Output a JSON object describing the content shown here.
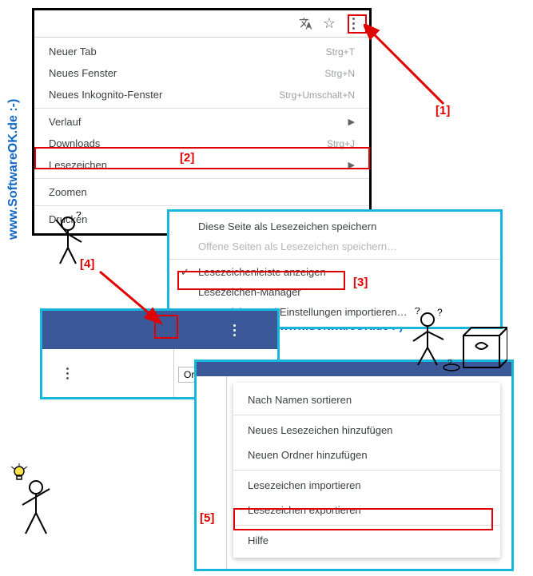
{
  "watermark": "www.SoftwareOK.de :-)",
  "steps": {
    "s1": "[1]",
    "s2": "[2]",
    "s3": "[3]",
    "s4": "[4]",
    "s5": "[5]"
  },
  "panel1": {
    "items": [
      {
        "label": "Neuer Tab",
        "shortcut": "Strg+T"
      },
      {
        "label": "Neues Fenster",
        "shortcut": "Strg+N"
      },
      {
        "label": "Neues Inkognito-Fenster",
        "shortcut": "Strg+Umschalt+N"
      }
    ],
    "verlauf": "Verlauf",
    "downloads": {
      "label": "Downloads",
      "shortcut": "Strg+J"
    },
    "lesezeichen": "Lesezeichen",
    "zoomen": "Zoomen",
    "drucken": "Drucken"
  },
  "panel2": {
    "save_page": "Diese Seite als Lesezeichen speichern",
    "save_open": "Offene Seiten als Lesezeichen speichern…",
    "show_bar": "Lesezeichenleiste anzeigen",
    "manager": "Lesezeichen-Manager",
    "import": "Lesezeichen und Einstellungen importieren…"
  },
  "panel3": {
    "tooltip": "Organisieren"
  },
  "panel4": {
    "sort": "Nach Namen sortieren",
    "add_bm": "Neues Lesezeichen hinzufügen",
    "add_folder": "Neuen Ordner hinzufügen",
    "import": "Lesezeichen importieren",
    "export": "Lesezeichen exportieren",
    "help": "Hilfe"
  }
}
